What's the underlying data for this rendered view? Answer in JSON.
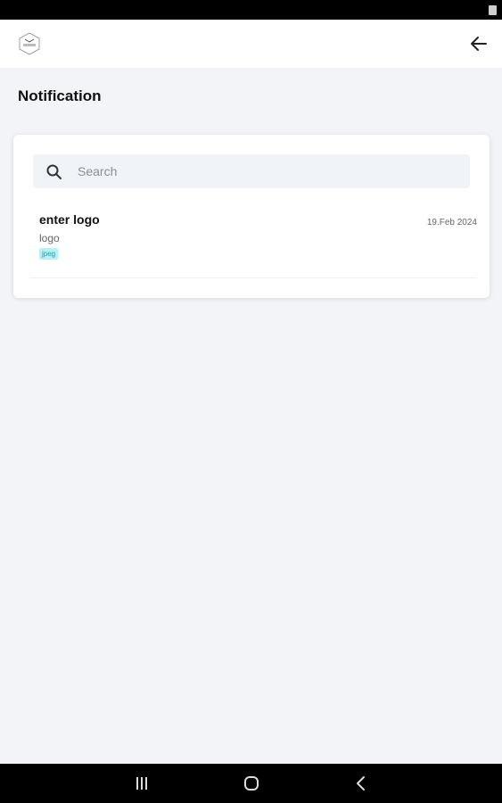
{
  "app_bar": {
    "logo": "imagine-logo",
    "back_icon": "arrow-left-icon"
  },
  "page": {
    "title": "Notification"
  },
  "search": {
    "placeholder": "Search",
    "value": ""
  },
  "notifications": [
    {
      "title": "enter logo",
      "subtitle": "logo",
      "tag": "jpeg",
      "date": "19.Feb 2024"
    }
  ],
  "nav_bar": {
    "items": [
      "recents-icon",
      "home-icon",
      "back-icon"
    ]
  },
  "colors": {
    "background": "#f2f4f8",
    "card": "#ffffff",
    "tag_bg": "#b8f0f5",
    "tag_text": "#2a9aa6"
  }
}
